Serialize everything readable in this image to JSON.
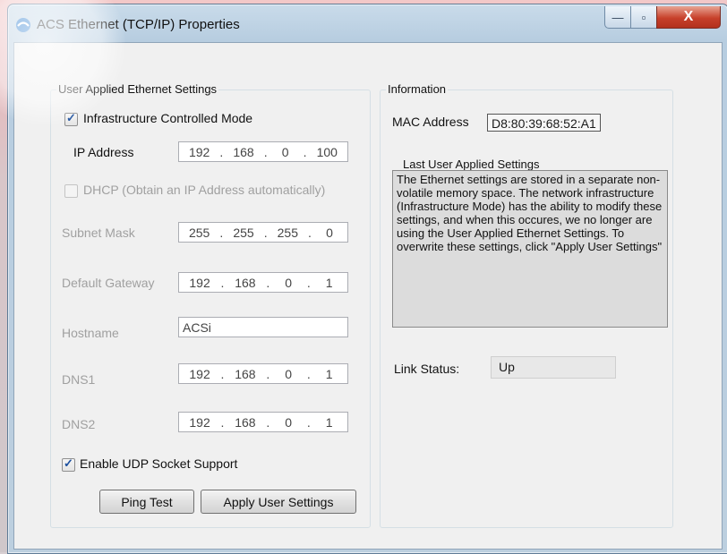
{
  "window": {
    "title": "ACS Ethernet (TCP/IP) Properties",
    "min_glyph": "—",
    "max_glyph": "▫",
    "close_glyph": "X"
  },
  "user_settings": {
    "group_title": "User Applied Ethernet Settings",
    "infrastructure_mode": {
      "label": "Infrastructure Controlled Mode",
      "checked": true
    },
    "ip_address": {
      "label": "IP Address",
      "octets": [
        "192",
        "168",
        "0",
        "100"
      ]
    },
    "dhcp": {
      "label": "DHCP (Obtain an IP Address automatically)",
      "checked": false,
      "enabled": false
    },
    "subnet_mask": {
      "label": "Subnet Mask",
      "octets": [
        "255",
        "255",
        "255",
        "0"
      ]
    },
    "default_gateway": {
      "label": "Default Gateway",
      "octets": [
        "192",
        "168",
        "0",
        "1"
      ]
    },
    "hostname": {
      "label": "Hostname",
      "value": "ACSi"
    },
    "dns1": {
      "label": "DNS1",
      "octets": [
        "192",
        "168",
        "0",
        "1"
      ]
    },
    "dns2": {
      "label": "DNS2",
      "octets": [
        "192",
        "168",
        "0",
        "1"
      ]
    },
    "udp": {
      "label": "Enable UDP Socket Support",
      "checked": true
    },
    "ping_button": "Ping Test",
    "apply_button": "Apply User Settings"
  },
  "information": {
    "group_title": "Information",
    "mac_label": "MAC Address",
    "mac_value": "D8:80:39:68:52:A1",
    "last_settings_title": "Last User Applied Settings",
    "last_settings_text": "The Ethernet settings are stored in a separate non-volatile memory space. The network infrastructure (Infrastructure Mode) has the ability to modify these settings, and when this occures, we no longer are using the User Applied Ethernet Settings.  To overwrite these settings, click \"Apply User Settings\"",
    "link_status_label": "Link Status:",
    "link_status_value": "Up"
  },
  "icons": {
    "app": "app-swirl-icon",
    "check": "checkmark-icon"
  },
  "colors": {
    "accent": "#1b4f9e",
    "close_red": "#c7402b",
    "disabled_text": "#a0a0a0"
  }
}
